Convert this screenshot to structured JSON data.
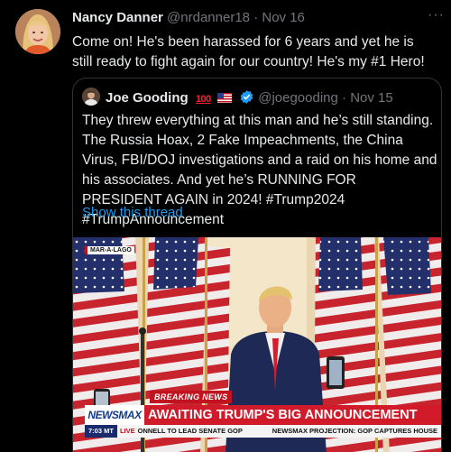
{
  "tweet": {
    "author_name": "Nancy Danner",
    "author_handle": "@nrdanner18",
    "separator": "·",
    "date": "Nov 16",
    "more_label": "···",
    "text": "Come on! He's been harassed for 6 years and yet he is still ready to fight again for our country! He's my #1 Hero!"
  },
  "quoted_tweet": {
    "author_name": "Joe Gooding",
    "badge_100": "100",
    "author_handle": "@joegooding",
    "separator": "·",
    "date": "Nov 15",
    "text": "They threw everything at this man and he’s still standing. The Russia Hoax, 2 Fake Impeachments, the China Virus, FBI/DOJ investigations and a raid on his home and his associates. And yet he’s RUNNING FOR PRESIDENT AGAIN in 2024! #Trump2024 #TrumpAnnouncement",
    "show_thread_label": "Show this thread"
  },
  "media": {
    "location_bug": "MAR-A-LAGO",
    "breaking_label": "BREAKING NEWS",
    "network_logo": "NEWSMAX",
    "headline": "AWAITING TRUMP'S BIG ANNOUNCEMENT",
    "ticker_time": "7:03 MT",
    "ticker_live": "LIVE",
    "ticker_text": "ONNELL TO LEAD SENATE GOP",
    "ticker_right": "NEWSMAX PROJECTION: GOP CAPTURES HOUSE"
  },
  "colors": {
    "background": "#000000",
    "text_primary": "#e7e9ea",
    "text_muted": "#71767b",
    "link_blue": "#1d9bf0",
    "verified_blue": "#1d9bf0",
    "news_red": "#d11a2a"
  },
  "icons": {
    "more": "more-horizontal-icon",
    "verified": "verified-badge-icon",
    "flag": "us-flag-icon"
  }
}
